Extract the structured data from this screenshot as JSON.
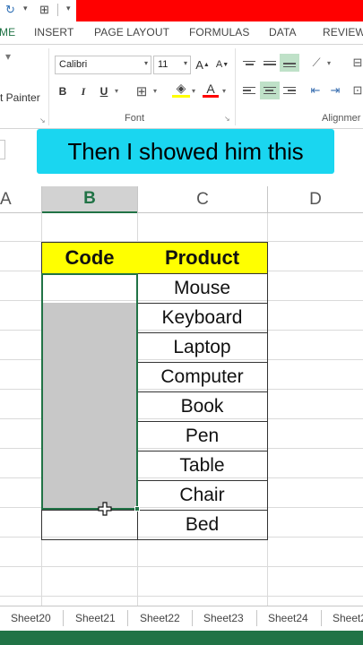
{
  "quick_access": {
    "icons": [
      "redo-icon",
      "borders-icon"
    ]
  },
  "ribbon_tabs": [
    "ME",
    "INSERT",
    "PAGE LAYOUT",
    "FORMULAS",
    "DATA",
    "REVIEW"
  ],
  "ribbon": {
    "painter_label": "t Painter",
    "font_name": "Calibri",
    "font_size": "11",
    "grow_font": "A",
    "shrink_font": "A",
    "bold": "B",
    "italic": "I",
    "underline": "U",
    "font_color_letter": "A",
    "font_group_label": "Font",
    "alignment_group_label": "Alignmer"
  },
  "caption": "Then I showed him this",
  "columns": [
    {
      "label": "A",
      "selected": false
    },
    {
      "label": "B",
      "selected": true
    },
    {
      "label": "C",
      "selected": false
    },
    {
      "label": "D",
      "selected": false
    }
  ],
  "table": {
    "headers": [
      "Code",
      "Product"
    ],
    "rows": [
      {
        "code": "",
        "product": "Mouse"
      },
      {
        "code": "",
        "product": "Keyboard"
      },
      {
        "code": "",
        "product": "Laptop"
      },
      {
        "code": "",
        "product": "Computer"
      },
      {
        "code": "",
        "product": "Book"
      },
      {
        "code": "",
        "product": "Pen"
      },
      {
        "code": "",
        "product": "Table"
      },
      {
        "code": "",
        "product": "Chair"
      },
      {
        "code": "",
        "product": "Bed"
      }
    ]
  },
  "sheets": [
    "Sheet20",
    "Sheet21",
    "Sheet22",
    "Sheet23",
    "Sheet24",
    "Sheet2"
  ],
  "colors": {
    "accent": "#217346",
    "header_fill": "#ffff00",
    "caption_bg": "#1ad6f0",
    "selection_fill": "#c8c8c8",
    "banner": "#ff0000"
  }
}
